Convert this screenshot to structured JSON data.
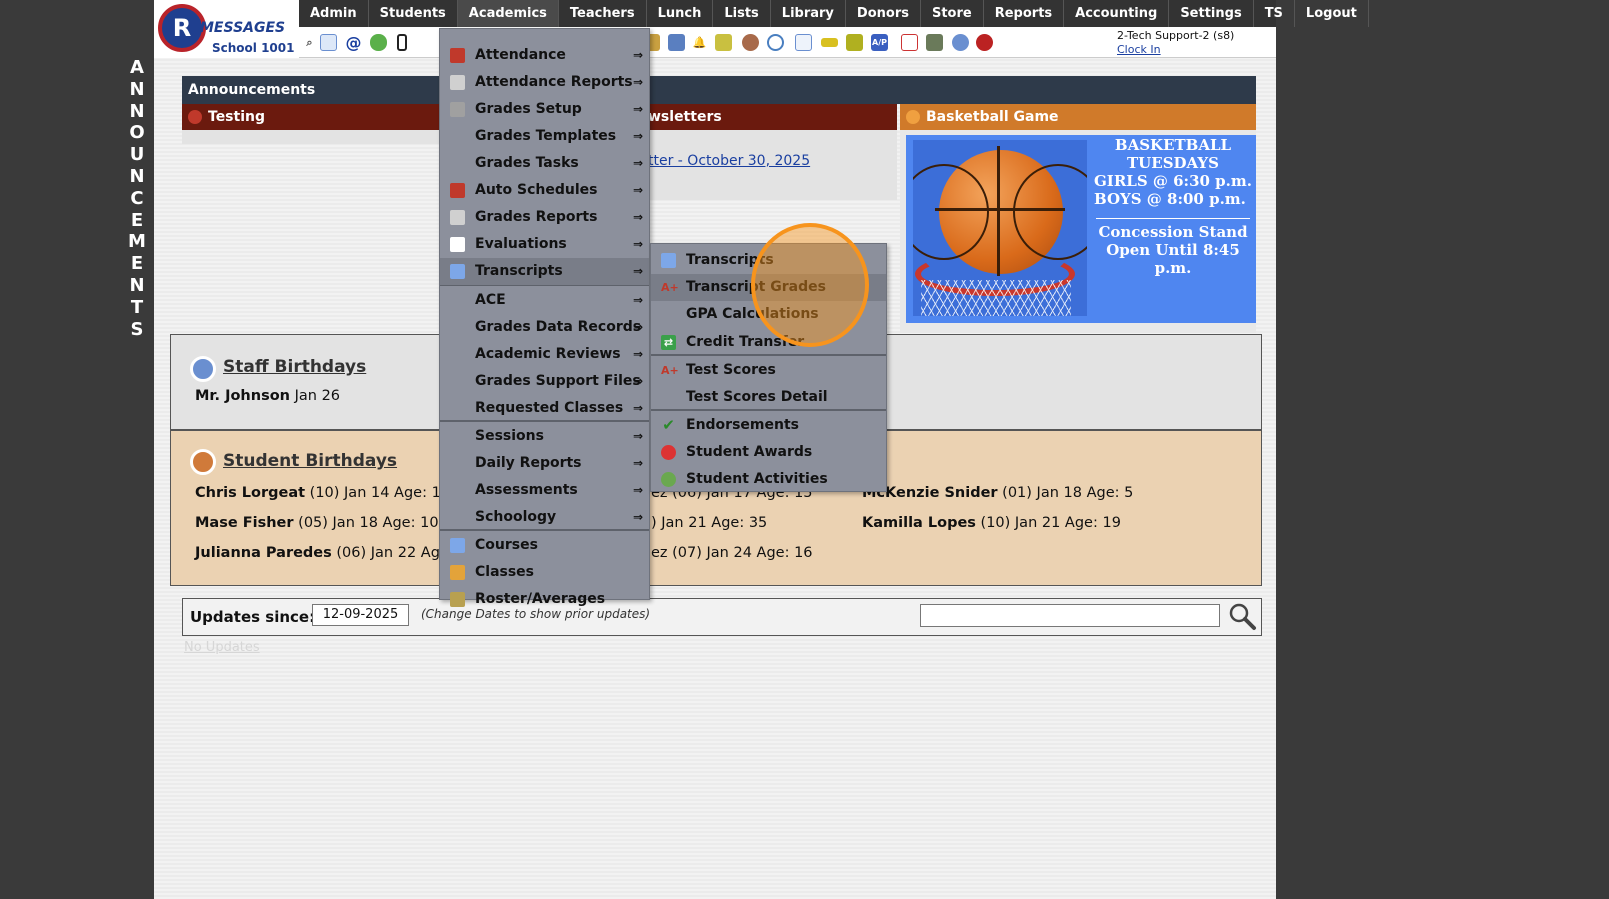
{
  "side_banner": [
    "A",
    "N",
    "N",
    "O",
    "U",
    "N",
    "C",
    "E",
    "M",
    "E",
    "N",
    "T",
    "S"
  ],
  "logo": {
    "initial": "R",
    "name": "MESSAGES",
    "school": "School 1001"
  },
  "topnav": [
    {
      "label": "Admin",
      "active": false
    },
    {
      "label": "Students",
      "active": false
    },
    {
      "label": "Academics",
      "active": true
    },
    {
      "label": "Teachers",
      "active": false
    },
    {
      "label": "Lunch",
      "active": false
    },
    {
      "label": "Lists",
      "active": false
    },
    {
      "label": "Library",
      "active": false
    },
    {
      "label": "Donors",
      "active": false
    },
    {
      "label": "Store",
      "active": false
    },
    {
      "label": "Reports",
      "active": false
    },
    {
      "label": "Accounting",
      "active": false
    },
    {
      "label": "Settings",
      "active": false
    },
    {
      "label": "TS",
      "active": false
    },
    {
      "label": "Logout",
      "active": false
    }
  ],
  "user": {
    "name": "2-Tech Support-2 (s8)",
    "clock_in": "Clock In"
  },
  "announcements": {
    "title": "Announcements",
    "testing_header": "Testing",
    "news_header": "wsletters",
    "news_link": "tter - October 30, 2025",
    "bb_header": "Basketball Game",
    "bb_line1": "BASKETBALL",
    "bb_line2": "TUESDAYS",
    "bb_line3": "GIRLS @ 6:30 p.m.",
    "bb_line4": "BOYS  @ 8:00 p.m.",
    "bb_line5": "Concession Stand",
    "bb_line6": "Open Until 8:45 p.m."
  },
  "staff_birthdays": {
    "title": "Staff Birthdays",
    "entries": [
      {
        "name": "Mr. Johnson",
        "detail": " Jan 26"
      }
    ]
  },
  "student_birthdays": {
    "title": "Student Birthdays",
    "entries": [
      {
        "name": "Chris Lorgeat",
        "detail": " (10) Jan 14 Age: 19"
      },
      {
        "name": "Mase Fisher",
        "detail": " (05) Jan 18 Age: 10"
      },
      {
        "name": "Julianna Paredes",
        "detail": " (06) Jan 22 Age:"
      },
      {
        "name": "",
        "detail": "ez (06) Jan 17 Age: 15"
      },
      {
        "name": "",
        "detail": ") Jan 21 Age: 35"
      },
      {
        "name": "",
        "detail": "ez (07) Jan 24 Age: 16"
      },
      {
        "name": "McKenzie Snider",
        "detail": " (01) Jan 18 Age: 5"
      },
      {
        "name": "Kamilla Lopes",
        "detail": " (10) Jan 21 Age: 19"
      }
    ]
  },
  "updates": {
    "label": "Updates since:",
    "date": "12-09-2025",
    "note": "(Change Dates to show prior updates)",
    "search_placeholder": "",
    "faded": "No Updates"
  },
  "academics_menu": [
    {
      "label": "Attendance",
      "arrow": "⇒",
      "icon": "calendar-icon",
      "color": "#c0392b"
    },
    {
      "label": "Attendance Reports",
      "arrow": "⇒",
      "icon": "printer-icon",
      "color": "#d0d0d0"
    },
    {
      "label": "Grades Setup",
      "arrow": "⇒",
      "icon": "gear-icon",
      "color": "#a0a0a0"
    },
    {
      "label": "Grades Templates",
      "arrow": "⇒",
      "icon": "",
      "color": ""
    },
    {
      "label": "Grades Tasks",
      "arrow": "⇒",
      "icon": "",
      "color": ""
    },
    {
      "label": "Auto Schedules",
      "arrow": "⇒",
      "icon": "calendar-icon",
      "color": "#c0392b"
    },
    {
      "label": "Grades Reports",
      "arrow": "⇒",
      "icon": "printer-icon",
      "color": "#d0d0d0"
    },
    {
      "label": "Evaluations",
      "arrow": "⇒",
      "icon": "checkbox-icon",
      "color": "#ffffff"
    },
    {
      "label": "Transcripts",
      "arrow": "⇒",
      "icon": "document-icon",
      "color": "#7da7e8"
    },
    {
      "label": "ACE",
      "arrow": "⇒",
      "icon": "",
      "color": ""
    },
    {
      "label": "Grades Data Records",
      "arrow": "⇒",
      "icon": "",
      "color": ""
    },
    {
      "label": "Academic Reviews",
      "arrow": "⇒",
      "icon": "",
      "color": ""
    },
    {
      "label": "Grades Support Files",
      "arrow": "⇒",
      "icon": "",
      "color": ""
    },
    {
      "label": "Requested Classes",
      "arrow": "⇒",
      "icon": "",
      "color": ""
    },
    {
      "label": "Sessions",
      "arrow": "⇒",
      "icon": "",
      "color": ""
    },
    {
      "label": "Daily Reports",
      "arrow": "⇒",
      "icon": "",
      "color": ""
    },
    {
      "label": "Assessments",
      "arrow": "⇒",
      "icon": "",
      "color": ""
    },
    {
      "label": "Schoology",
      "arrow": "⇒",
      "icon": "",
      "color": ""
    },
    {
      "label": "Courses",
      "arrow": "",
      "icon": "book-icon",
      "color": "#7da7e8"
    },
    {
      "label": "Classes",
      "arrow": "",
      "icon": "person-icon",
      "color": "#e3a33a"
    },
    {
      "label": "Roster/Averages",
      "arrow": "",
      "icon": "roster-icon",
      "color": "#b8a050"
    }
  ],
  "transcripts_submenu": [
    {
      "label": "Transcripts",
      "icon": "document-icon",
      "glyph": "",
      "color": "#7da7e8"
    },
    {
      "label": "Transcript Grades",
      "icon": "grade-icon",
      "glyph": "A+",
      "color": "transparent"
    },
    {
      "label": "GPA Calculations",
      "icon": "",
      "glyph": "",
      "color": ""
    },
    {
      "label": "Credit Transfer",
      "icon": "transfer-icon",
      "glyph": "⇄",
      "color": "#3aa04a"
    },
    {
      "label": "Test Scores",
      "icon": "grade-icon",
      "glyph": "A+",
      "color": "transparent"
    },
    {
      "label": "Test Scores Detail",
      "icon": "",
      "glyph": "",
      "color": ""
    },
    {
      "label": "Endorsements",
      "icon": "checkmark-icon",
      "glyph": "✔",
      "color": "transparent"
    },
    {
      "label": "Student Awards",
      "icon": "ribbon-icon",
      "glyph": "",
      "color": "#d33"
    },
    {
      "label": "Student Activities",
      "icon": "people-icon",
      "glyph": "",
      "color": "#6aa84f"
    }
  ]
}
